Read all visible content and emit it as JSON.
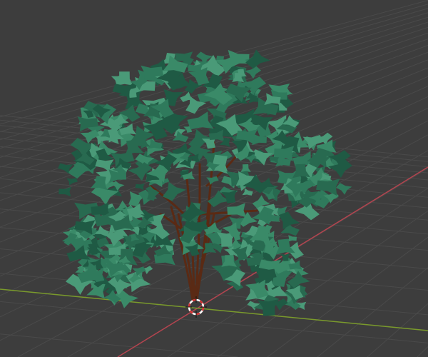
{
  "viewport": {
    "background": "#3d3d3d",
    "grid_color": "#4a4a4a",
    "x_axis_color": "#b4444f",
    "y_axis_color": "#7a9a2c"
  },
  "tree": {
    "trunk_color": "#5a2a14",
    "foliage_colors": [
      "#2f7a5c",
      "#3a8a68",
      "#286a50",
      "#4a9a78",
      "#1f5a44"
    ]
  },
  "cursor": {
    "ring_red": "#d03030",
    "ring_white": "#ffffff"
  }
}
